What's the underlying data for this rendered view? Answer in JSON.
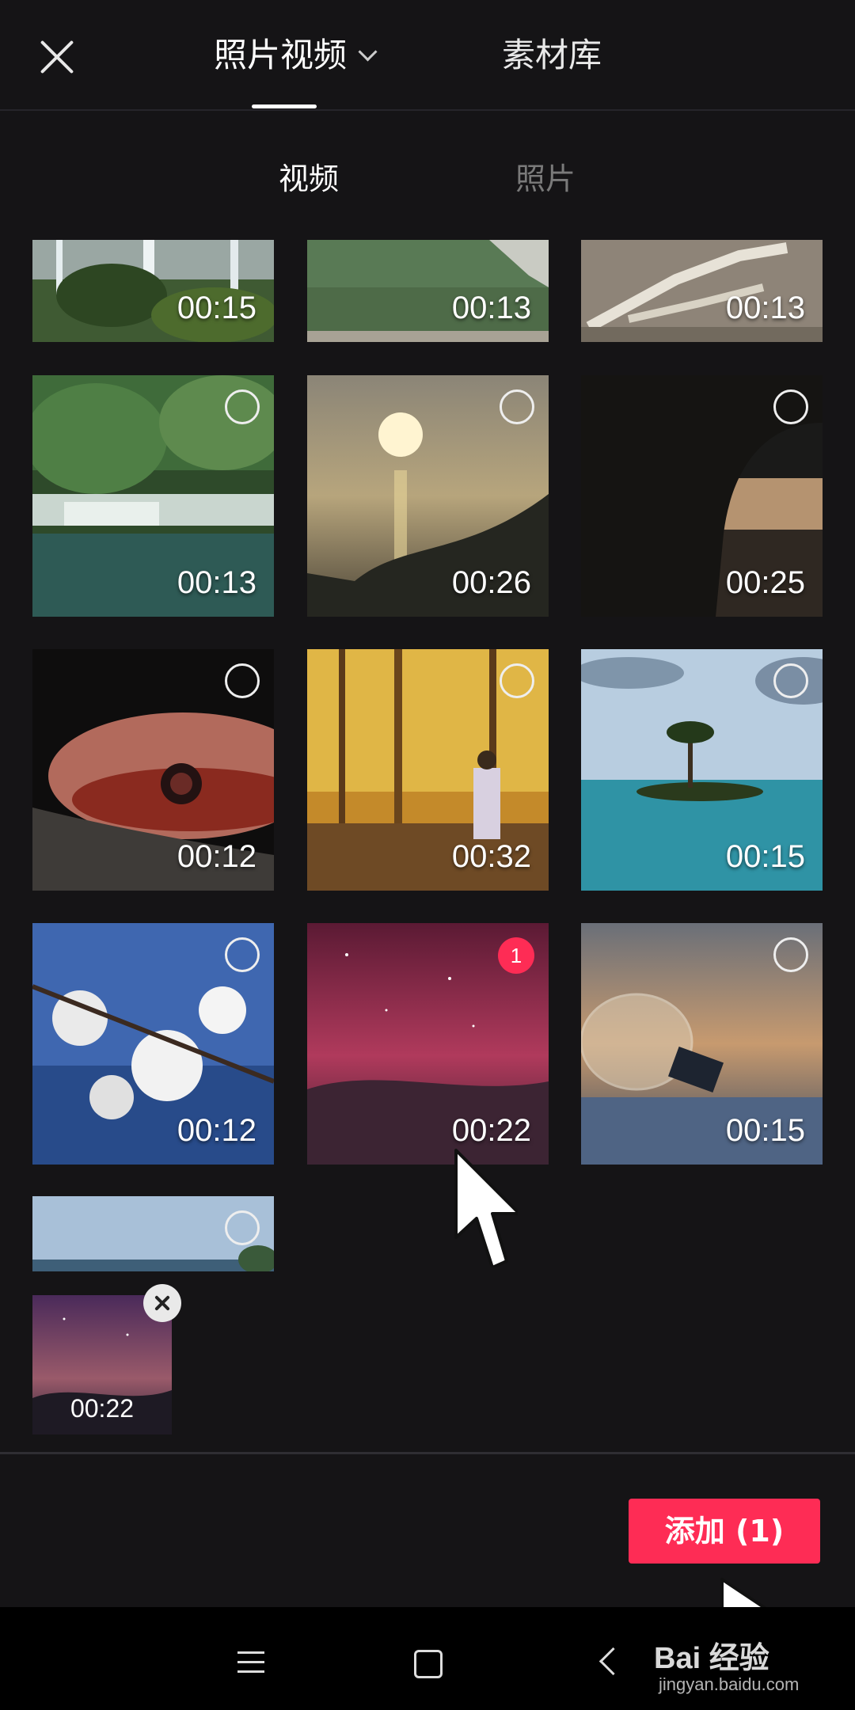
{
  "header": {
    "tabs": [
      {
        "label": "照片视频",
        "active": true
      },
      {
        "label": "素材库",
        "active": false
      }
    ]
  },
  "sub_tabs": [
    {
      "label": "视频",
      "active": true
    },
    {
      "label": "照片",
      "active": false
    }
  ],
  "grid": {
    "items": [
      {
        "duration": "00:15",
        "scene": "waterfall-forest",
        "selected": false
      },
      {
        "duration": "00:13",
        "scene": "green-lake-shore",
        "selected": false
      },
      {
        "duration": "00:13",
        "scene": "driftwood-sand",
        "selected": false
      },
      {
        "duration": "00:13",
        "scene": "forest-stream",
        "selected": false
      },
      {
        "duration": "00:26",
        "scene": "sunset-sea",
        "selected": false
      },
      {
        "duration": "00:25",
        "scene": "tree-silhouette",
        "selected": false
      },
      {
        "duration": "00:12",
        "scene": "frog-closeup",
        "selected": false
      },
      {
        "duration": "00:32",
        "scene": "autumn-forest-walker",
        "selected": false
      },
      {
        "duration": "00:15",
        "scene": "palm-island",
        "selected": false
      },
      {
        "duration": "00:12",
        "scene": "white-blossoms",
        "selected": false
      },
      {
        "duration": "00:22",
        "scene": "starry-night-sky",
        "selected": true,
        "selection_index": "1"
      },
      {
        "duration": "00:15",
        "scene": "lightbulb-snow",
        "selected": false
      },
      {
        "duration": "",
        "scene": "sea-horizon",
        "selected": false
      }
    ]
  },
  "selection_strip": {
    "items": [
      {
        "duration": "00:22",
        "scene": "starry-night-sky"
      }
    ]
  },
  "add_button": {
    "label": "添加 (1)"
  },
  "watermark": {
    "main": "Bai 经验",
    "sub": "jingyan.baidu.com"
  },
  "icons": {
    "close": "close-icon",
    "dropdown": "chevron-down-icon",
    "remove": "remove-icon",
    "nav_menu": "menu-icon",
    "nav_home": "home-icon",
    "nav_back": "back-icon"
  },
  "colors": {
    "background": "#151416",
    "accent": "#fe2c55",
    "navbar": "#000000"
  }
}
